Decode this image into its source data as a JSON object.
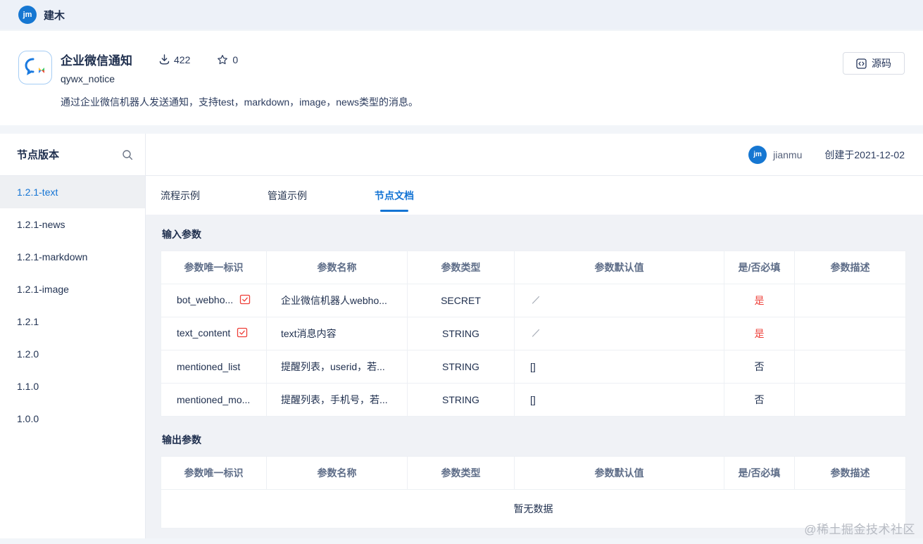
{
  "colors": {
    "accent": "#1677d2",
    "red": "#ee3f38",
    "navy": "#20304f"
  },
  "topbar": {
    "brand": "建木",
    "logo_text": "jm"
  },
  "header": {
    "title": "企业微信通知",
    "subtitle": "qywx_notice",
    "downloads": "422",
    "stars": "0",
    "description": "通过企业微信机器人发送通知，支持test，markdown，image，news类型的消息。",
    "source_button": "源码"
  },
  "sidebar": {
    "title": "节点版本",
    "versions": [
      {
        "label": "1.2.1-text",
        "active": true
      },
      {
        "label": "1.2.1-news",
        "active": false
      },
      {
        "label": "1.2.1-markdown",
        "active": false
      },
      {
        "label": "1.2.1-image",
        "active": false
      },
      {
        "label": "1.2.1",
        "active": false
      },
      {
        "label": "1.2.0",
        "active": false
      },
      {
        "label": "1.1.0",
        "active": false
      },
      {
        "label": "1.0.0",
        "active": false
      }
    ]
  },
  "content": {
    "author": "jianmu",
    "avatar_text": "jm",
    "created": "创建于2021-12-02",
    "tabs": [
      {
        "label": "流程示例",
        "active": false
      },
      {
        "label": "管道示例",
        "active": false
      },
      {
        "label": "节点文档",
        "active": true
      }
    ],
    "table_columns": [
      "参数唯一标识",
      "参数名称",
      "参数类型",
      "参数默认值",
      "是/否必填",
      "参数描述"
    ],
    "input_section": {
      "title": "输入参数",
      "rows": [
        {
          "id": "bot_webho...",
          "name": "企业微信机器人webho...",
          "type": "SECRET",
          "default": "",
          "required": "是",
          "desc": ""
        },
        {
          "id": "text_content",
          "name": "text消息内容",
          "type": "STRING",
          "default": "",
          "required": "是",
          "desc": ""
        },
        {
          "id": "mentioned_list",
          "name": "提醒列表，userid，若...",
          "type": "STRING",
          "default": "[]",
          "required": "否",
          "desc": ""
        },
        {
          "id": "mentioned_mo...",
          "name": "提醒列表，手机号，若...",
          "type": "STRING",
          "default": "[]",
          "required": "否",
          "desc": ""
        }
      ]
    },
    "output_section": {
      "title": "输出参数",
      "empty_text": "暂无数据"
    }
  },
  "watermark": "@稀土掘金技术社区"
}
